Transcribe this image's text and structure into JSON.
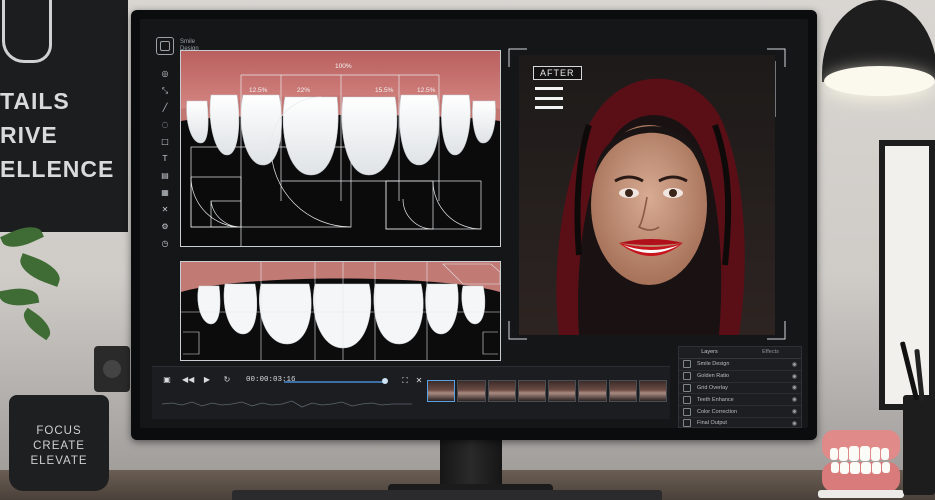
{
  "poster": {
    "lines": [
      "TAILS",
      "RIVE",
      "ELLENCE"
    ]
  },
  "mug": {
    "lines": [
      "FOCUS",
      "CREATE",
      "ELEVATE"
    ]
  },
  "app": {
    "brand": "Smile Design",
    "tools": [
      "target-icon",
      "expand-icon",
      "pen-icon",
      "tooth-icon",
      "square-icon",
      "text-icon",
      "document-icon",
      "grid-icon",
      "close-icon",
      "settings-icon",
      "clock-icon"
    ],
    "tool_glyphs": [
      "◎",
      "⤡",
      "╱",
      "◌",
      "□",
      "T",
      "▤",
      "▦",
      "✕",
      "⚙",
      "◷"
    ]
  },
  "measurements": {
    "top": "100%",
    "labels": [
      "12.5%",
      "22%",
      "15.5%",
      "12.5%"
    ]
  },
  "after": {
    "label": "AFTER"
  },
  "timeline": {
    "timecode": "00:00:03:16",
    "progress": 0.82,
    "thumb_count": 8
  },
  "layers": {
    "tabs": [
      "Layers",
      "Effects"
    ],
    "items": [
      "Smile Design",
      "Golden Ratio",
      "Grid Overlay",
      "Teeth Enhance",
      "Color Correction",
      "Final Output"
    ]
  },
  "colors": {
    "accent": "#3c6fa3",
    "lip": "#c8141c",
    "gum": "#c97a78"
  }
}
